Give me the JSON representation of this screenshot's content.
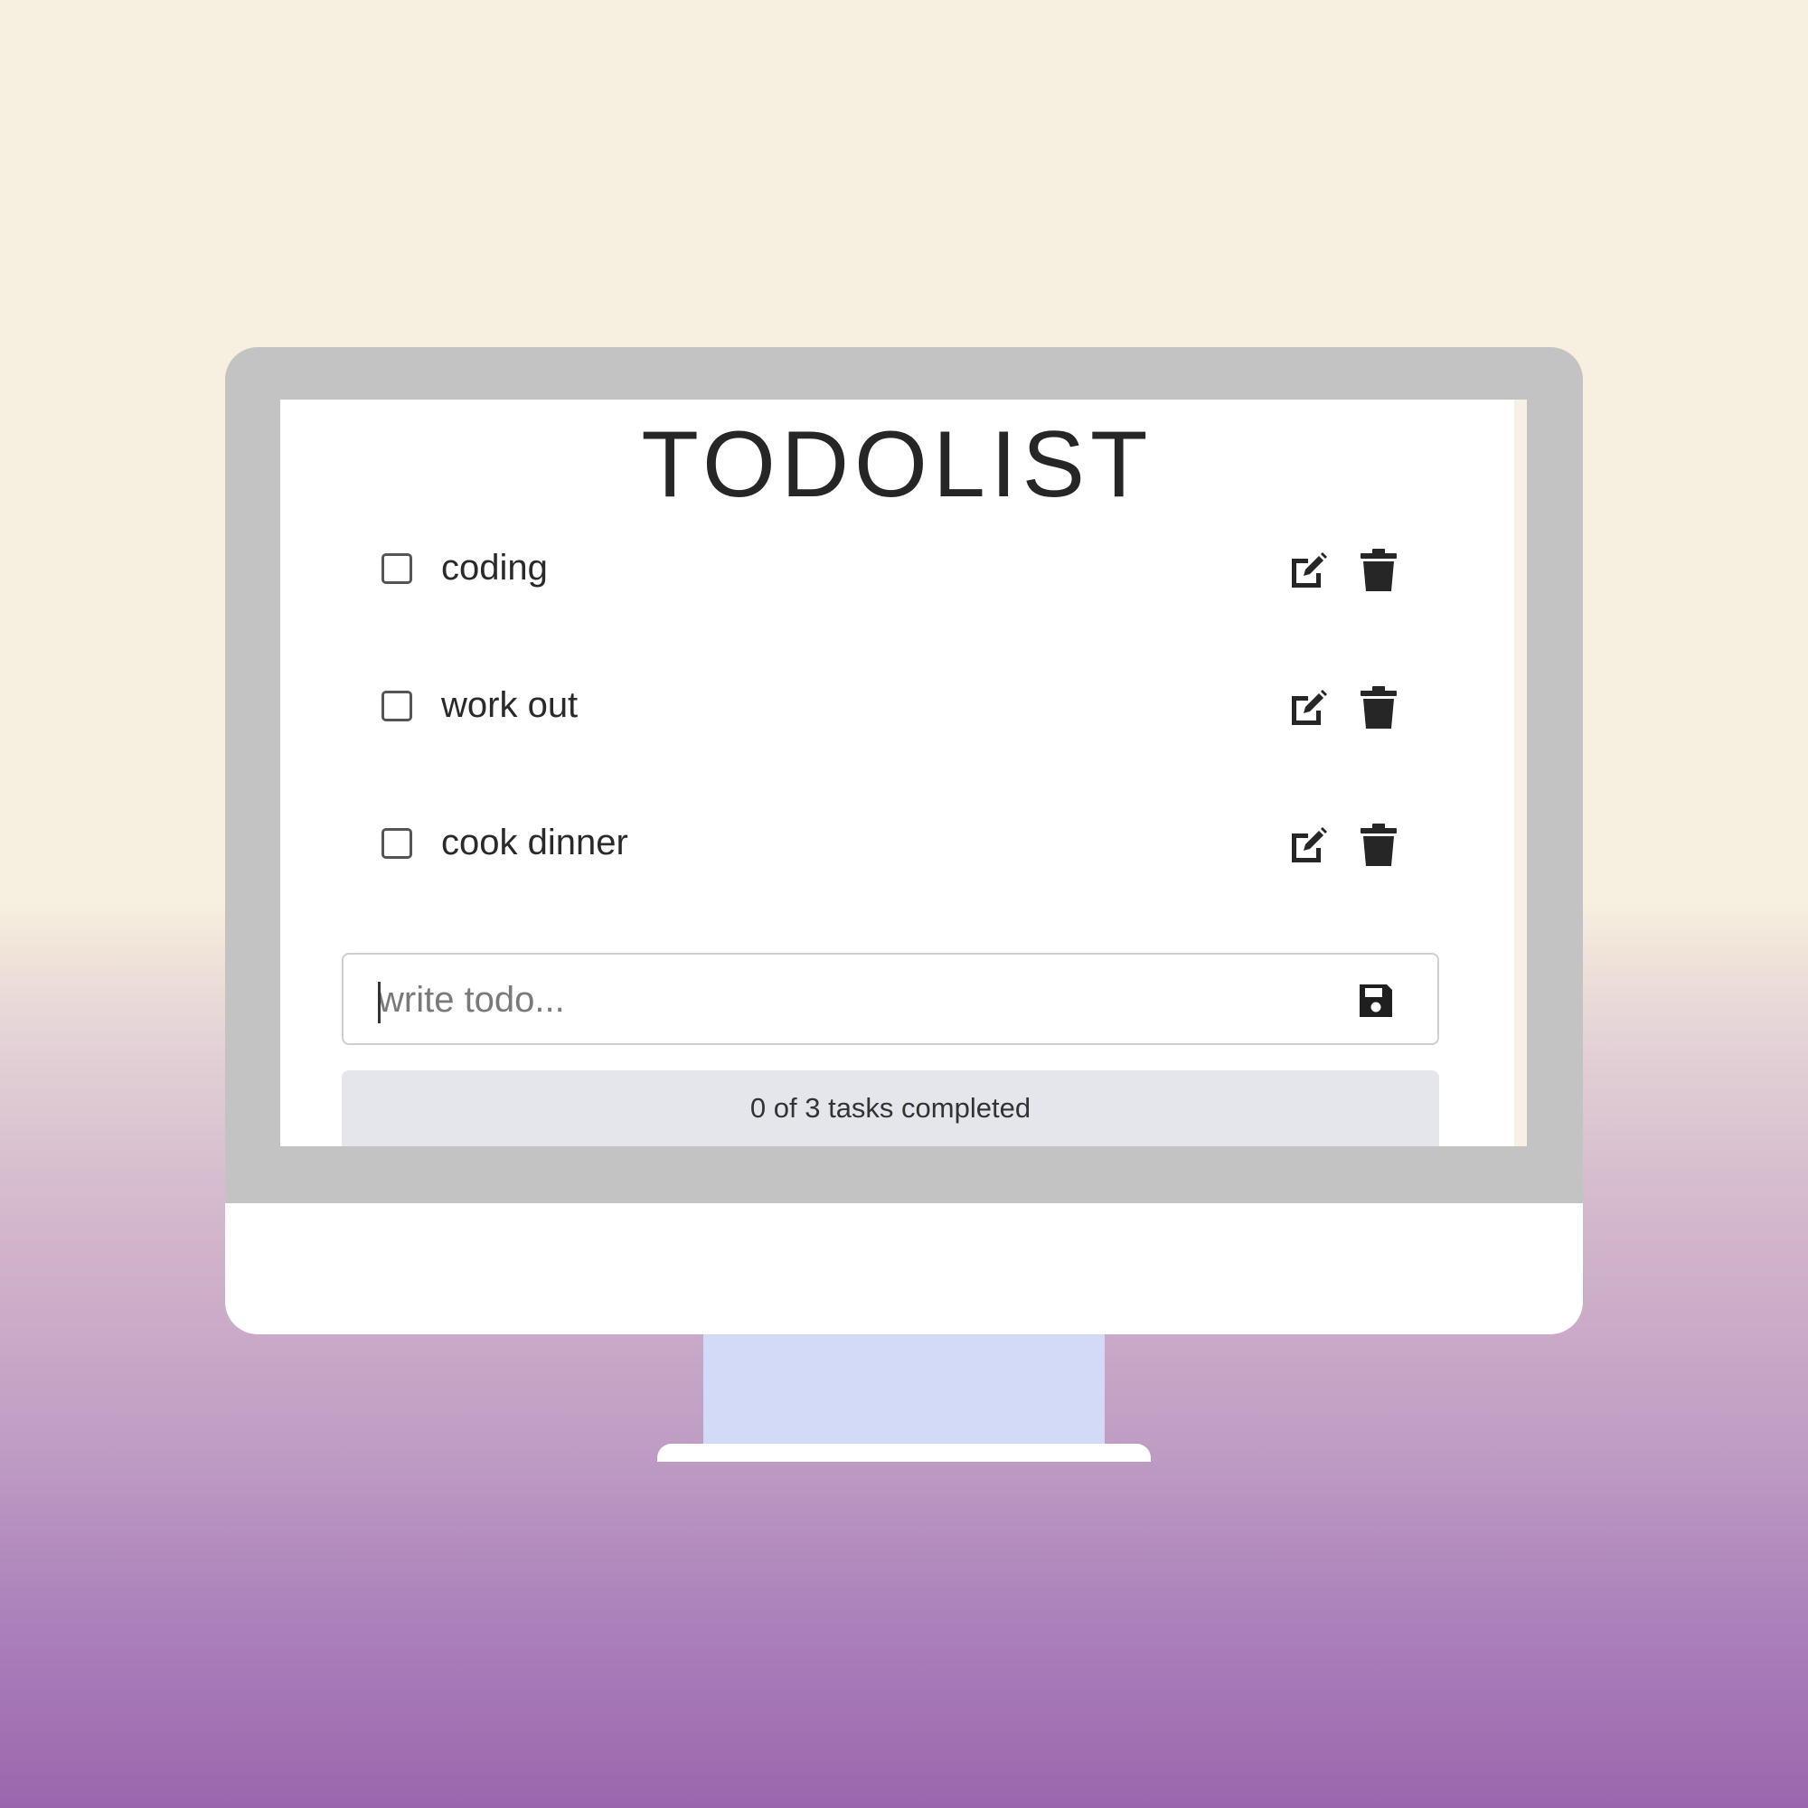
{
  "app": {
    "title": "TODOLIST"
  },
  "todos": [
    {
      "label": "coding",
      "completed": false
    },
    {
      "label": "work out",
      "completed": false
    },
    {
      "label": "cook dinner",
      "completed": false
    }
  ],
  "new_todo": {
    "placeholder": "write todo...",
    "value": ""
  },
  "status": {
    "text": "0 of 3 tasks completed"
  },
  "icons": {
    "edit": "edit-icon",
    "delete": "trash-icon",
    "save": "save-icon"
  },
  "colors": {
    "background_top": "#f7efdf",
    "background_bottom": "#9b66ad",
    "monitor_bezel": "#c3c3c3",
    "monitor_stand": "#d2daf7",
    "status_bar": "#e5e6eb"
  }
}
